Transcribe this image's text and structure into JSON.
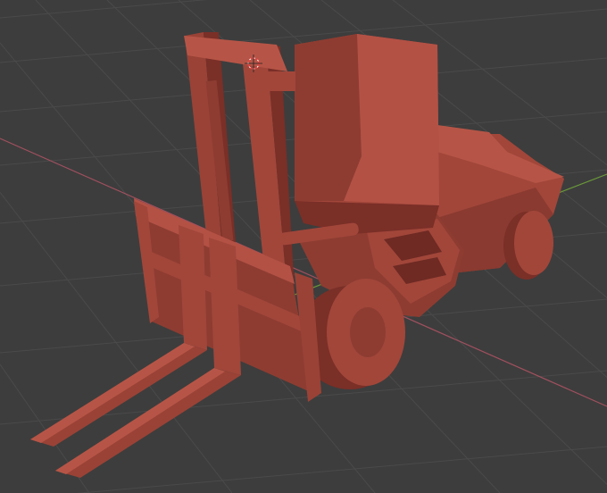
{
  "viewport": {
    "background_color": "#3d3d3d",
    "grid_color": "#4a4a4a",
    "x_axis_color": "#a0505e",
    "y_axis_color": "#6a9a3a"
  },
  "model": {
    "object": "forklift-mesh",
    "base_color": "#a2463a",
    "light_color": "#bb5a4b",
    "dark_color": "#7a2f27",
    "shadow_color": "#5f2620",
    "origin_marker": "3d-cursor-icon"
  }
}
